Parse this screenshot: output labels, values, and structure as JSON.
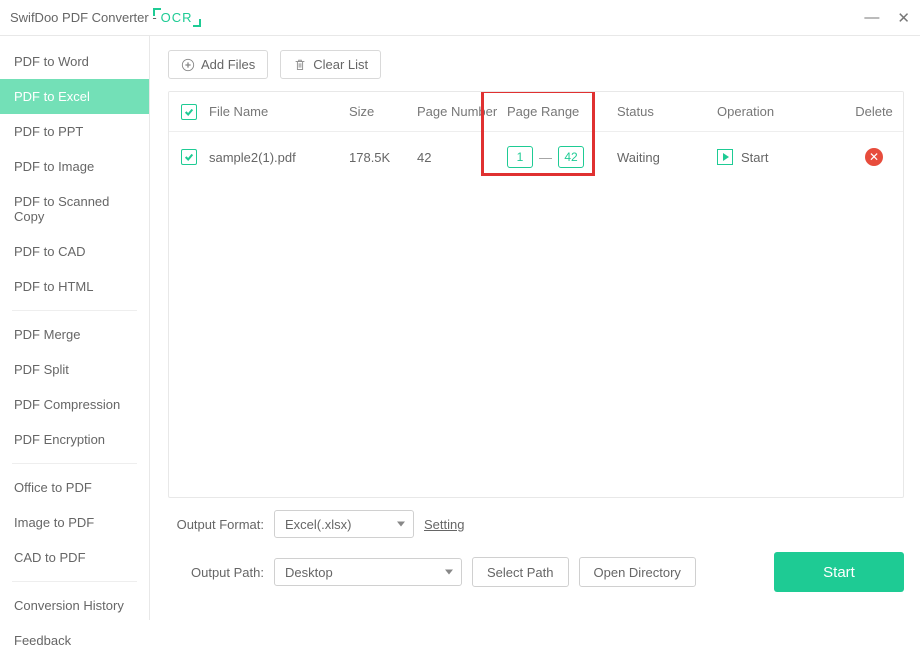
{
  "app": {
    "title": "SwifDoo PDF Converter - ",
    "ocr": "OCR"
  },
  "sidebar": {
    "items": [
      "PDF to Word",
      "PDF to Excel",
      "PDF to PPT",
      "PDF to Image",
      "PDF to Scanned Copy",
      "PDF to CAD",
      "PDF to HTML"
    ],
    "group2": [
      "PDF Merge",
      "PDF Split",
      "PDF Compression",
      "PDF Encryption"
    ],
    "group3": [
      "Office to PDF",
      "Image to PDF",
      "CAD to PDF"
    ],
    "group4": [
      "Conversion History",
      "Feedback"
    ],
    "active_index": 1
  },
  "toolbar": {
    "add_files": "Add Files",
    "clear_list": "Clear List"
  },
  "table": {
    "headers": {
      "file": "File Name",
      "size": "Size",
      "pagenum": "Page Number",
      "range": "Page Range",
      "status": "Status",
      "op": "Operation",
      "del": "Delete"
    },
    "rows": [
      {
        "file": "sample2(1).pdf",
        "size": "178.5K",
        "pagenum": "42",
        "range_from": "1",
        "range_to": "42",
        "status": "Waiting",
        "op": "Start"
      }
    ]
  },
  "footer": {
    "output_format_label": "Output Format:",
    "output_format_value": "Excel(.xlsx)",
    "setting": "Setting",
    "output_path_label": "Output Path:",
    "output_path_value": "Desktop",
    "select_path": "Select Path",
    "open_dir": "Open Directory",
    "start": "Start"
  }
}
